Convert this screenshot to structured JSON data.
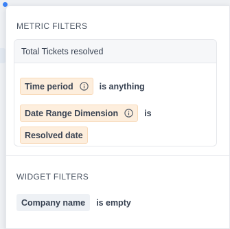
{
  "metric_filters": {
    "title": "METRIC FILTERS",
    "metric_name": "Total Tickets resolved",
    "filters": [
      {
        "field": "Time period",
        "operator": "is anything"
      },
      {
        "field": "Date Range Dimension",
        "operator": "is",
        "value": "Resolved date"
      }
    ]
  },
  "widget_filters": {
    "title": "WIDGET FILTERS",
    "filters": [
      {
        "field": "Company name",
        "operator": "is empty"
      }
    ]
  },
  "colors": {
    "accent": "#3b82f6",
    "chip_bg": "#fdeedd",
    "chip_border": "#f8d9b8",
    "neutral_chip_bg": "#eef1f5"
  },
  "icons": [
    "info-icon",
    "info-icon"
  ]
}
